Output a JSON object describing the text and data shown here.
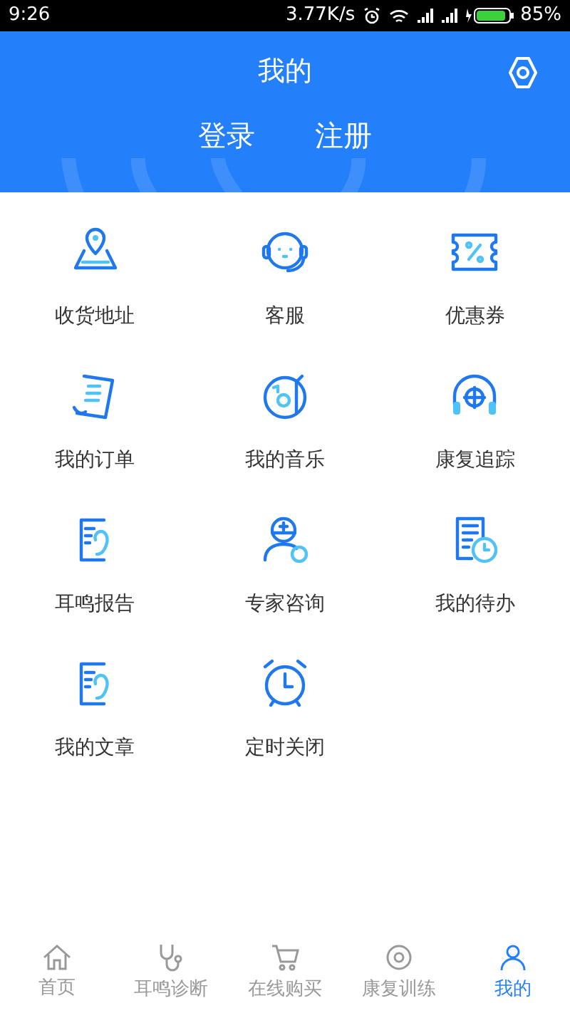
{
  "status_bar": {
    "time": "9:26",
    "speed": "3.77K/s",
    "battery": "85%"
  },
  "header": {
    "title": "我的",
    "login": "登录",
    "register": "注册"
  },
  "menu": [
    {
      "label": "收货地址"
    },
    {
      "label": "客服"
    },
    {
      "label": "优惠券"
    },
    {
      "label": "我的订单"
    },
    {
      "label": "我的音乐"
    },
    {
      "label": "康复追踪"
    },
    {
      "label": "耳鸣报告"
    },
    {
      "label": "专家咨询"
    },
    {
      "label": "我的待办"
    },
    {
      "label": "我的文章"
    },
    {
      "label": "定时关闭"
    }
  ],
  "tab_bar": [
    {
      "label": "首页",
      "selected": false
    },
    {
      "label": "耳鸣诊断",
      "selected": false
    },
    {
      "label": "在线购买",
      "selected": false
    },
    {
      "label": "康复训练",
      "selected": false
    },
    {
      "label": "我的",
      "selected": true
    }
  ]
}
